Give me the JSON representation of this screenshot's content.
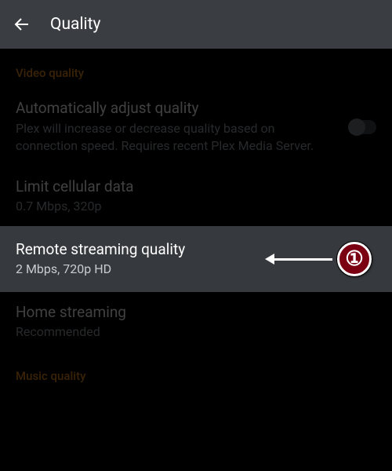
{
  "header": {
    "title": "Quality"
  },
  "sections": {
    "video": {
      "header": "Video quality",
      "autoAdjust": {
        "title": "Automatically adjust quality",
        "desc": "Plex will increase or decrease quality based on connection speed. Requires recent Plex Media Server.",
        "enabled": false
      },
      "limitCellular": {
        "title": "Limit cellular data",
        "value": "0.7 Mbps, 320p"
      },
      "remoteStreaming": {
        "title": "Remote streaming quality",
        "value": "2 Mbps, 720p HD"
      },
      "homeStreaming": {
        "title": "Home streaming",
        "value": "Recommended"
      }
    },
    "music": {
      "header": "Music quality"
    }
  },
  "annotation": {
    "number": "①"
  }
}
